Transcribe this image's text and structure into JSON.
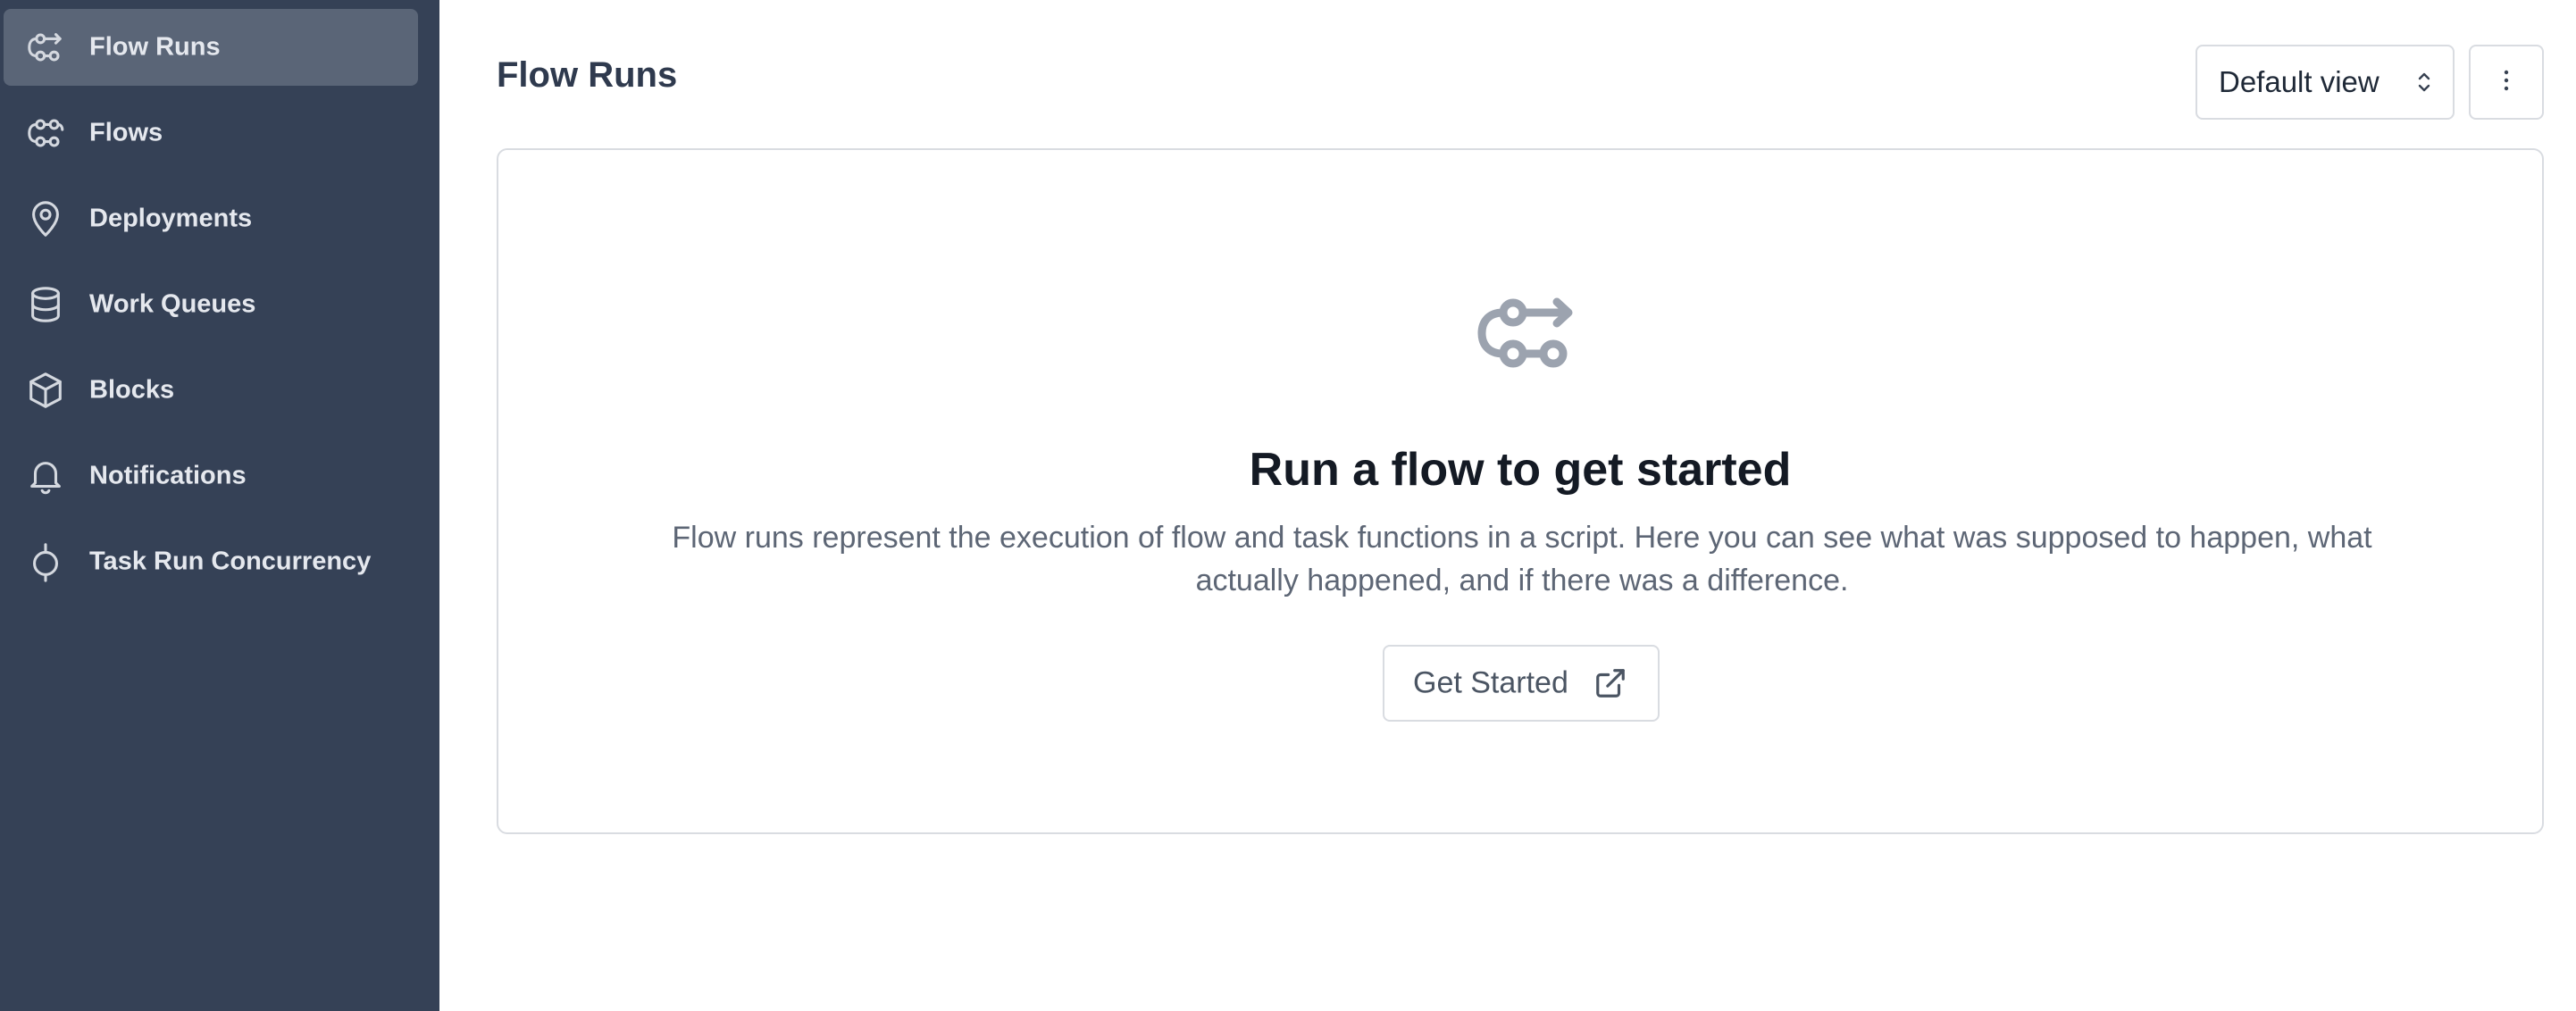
{
  "sidebar": {
    "items": [
      {
        "label": "Flow Runs",
        "icon": "flow-runs-icon",
        "active": true
      },
      {
        "label": "Flows",
        "icon": "flows-icon",
        "active": false
      },
      {
        "label": "Deployments",
        "icon": "map-pin-icon",
        "active": false
      },
      {
        "label": "Work Queues",
        "icon": "database-icon",
        "active": false
      },
      {
        "label": "Blocks",
        "icon": "cube-icon",
        "active": false
      },
      {
        "label": "Notifications",
        "icon": "bell-icon",
        "active": false
      },
      {
        "label": "Task Run Concurrency",
        "icon": "concurrency-icon",
        "active": false
      }
    ]
  },
  "header": {
    "title": "Flow Runs",
    "view_select": {
      "value": "Default view"
    },
    "more_icon": "vertical-dots-icon"
  },
  "empty_state": {
    "icon": "flow-runs-icon",
    "title": "Run a flow to get started",
    "description": "Flow runs represent the execution of flow and task functions in a script. Here you can see what was supposed to happen, what actually happened, and if there was a difference.",
    "button_label": "Get Started",
    "button_icon": "external-link-icon"
  },
  "colors": {
    "sidebar_bg": "#354156",
    "sidebar_active_bg": "#5a6577",
    "sidebar_text": "#e5e8ee",
    "title_text": "#2f3a4e",
    "border": "#d9dce1"
  }
}
